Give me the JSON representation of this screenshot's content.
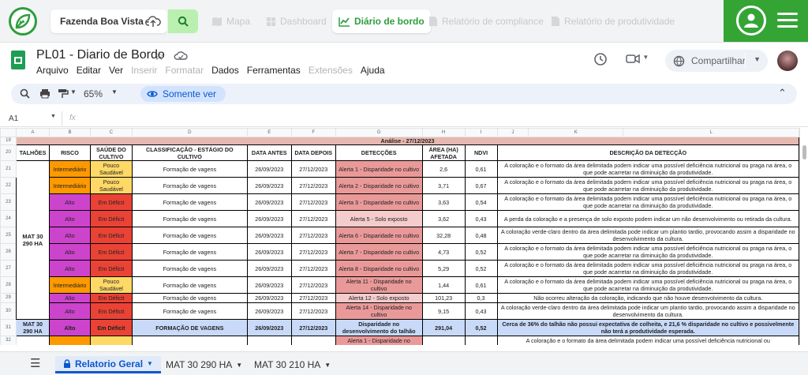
{
  "app": {
    "farm_name": "Fazenda Boa Vista -",
    "nav": [
      {
        "label": "Mapa",
        "icon": "map-icon"
      },
      {
        "label": "Dashboard",
        "icon": "dashboard-icon"
      },
      {
        "label": "Diário de bordo",
        "icon": "chart-line-icon",
        "active": true
      },
      {
        "label": "Relatório de compliance",
        "icon": "document-icon"
      },
      {
        "label": "Relatório de produtividade",
        "icon": "document-icon"
      }
    ],
    "accent_color": "#34a535"
  },
  "doc": {
    "title": "PL01 - Diario de Bordo",
    "menu": [
      {
        "label": "Arquivo",
        "disabled": false
      },
      {
        "label": "Editar",
        "disabled": false
      },
      {
        "label": "Ver",
        "disabled": false
      },
      {
        "label": "Inserir",
        "disabled": true
      },
      {
        "label": "Formatar",
        "disabled": true
      },
      {
        "label": "Dados",
        "disabled": false
      },
      {
        "label": "Ferramentas",
        "disabled": false
      },
      {
        "label": "Extensões",
        "disabled": true
      },
      {
        "label": "Ajuda",
        "disabled": false
      }
    ],
    "share_label": "Compartilhar"
  },
  "toolbar": {
    "zoom": "65%",
    "view_only_label": "Somente ver"
  },
  "formula_bar": {
    "cell_ref": "A1",
    "fx": "fx",
    "value": ""
  },
  "sheet": {
    "col_letters": [
      "A",
      "B",
      "C",
      "D",
      "E",
      "F",
      "G",
      "H",
      "I",
      "J",
      "K",
      "L"
    ],
    "section_title": "Análise - 27/12/2023",
    "headers": [
      "TALHÕES",
      "RISCO",
      "SAÚDE DO CULTIVO",
      "CLASSIFICAÇÃO - ESTÁGIO DO CULTIVO",
      "DATA ANTES",
      "DATA DEPOIS",
      "DETECÇÕES",
      "ÁREA (HA) AFETADA",
      "NDVI",
      "DESCRIÇÃO DA DETECÇÃO"
    ],
    "talhao_group": "MAT 30 290 HA",
    "rows": [
      {
        "rn": "21",
        "risco": "Intermediário",
        "saude": "Pouco Saudável",
        "classif": "Formação de vagens",
        "antes": "26/09/2023",
        "depois": "27/12/2023",
        "deteccao": "Alerta 1 - Disparidade no cultivo",
        "area": "2,6",
        "ndvi": "0,61",
        "desc": "A coloração e o formato da área delimitada podem indicar uma possível deficiência nutricional ou praga na área, o que pode acarretar na diminuição da produtividade."
      },
      {
        "rn": "22",
        "risco": "Intermediário",
        "saude": "Pouco Saudável",
        "classif": "Formação de vagens",
        "antes": "26/09/2023",
        "depois": "27/12/2023",
        "deteccao": "Alerta 2 - Disparidade no cultivo",
        "area": "3,71",
        "ndvi": "0,67",
        "desc": "A coloração e o formato da área delimitada podem indicar uma possível deficiência nutricional ou praga na área, o que pode acarretar na diminuição da produtividade."
      },
      {
        "rn": "23",
        "risco": "Alto",
        "saude": "Em Déficit",
        "classif": "Formação de vagens",
        "antes": "26/09/2023",
        "depois": "27/12/2023",
        "deteccao": "Alerta 3 - Disparidade no cultivo",
        "area": "3,63",
        "ndvi": "0,54",
        "desc": "A coloração e o formato da área delimitada podem indicar uma possível deficiência nutricional ou praga na área, o que pode acarretar na diminuição da produtividade."
      },
      {
        "rn": "24",
        "risco": "Alto",
        "saude": "Em Déficit",
        "classif": "Formação de vagens",
        "antes": "26/09/2023",
        "depois": "27/12/2023",
        "deteccao": "Alerta 5 - Solo exposto",
        "area": "3,62",
        "ndvi": "0,43",
        "desc": "A perda da coloração e a presença de solo exposto podem indicar um não desenvolvimento ou retirada da cultura.",
        "solo": true
      },
      {
        "rn": "25",
        "risco": "Alto",
        "saude": "Em Déficit",
        "classif": "Formação de vagens",
        "antes": "26/09/2023",
        "depois": "27/12/2023",
        "deteccao": "Alerta 6 - Disparidade no cultivo",
        "area": "32,28",
        "ndvi": "0,48",
        "desc": "A coloração verde-claro dentro da área delimitada pode indicar um plantio tardio, provocando assim a disparidade no desenvolvimento da cultura."
      },
      {
        "rn": "26",
        "risco": "Alto",
        "saude": "Em Déficit",
        "classif": "Formação de vagens",
        "antes": "26/09/2023",
        "depois": "27/12/2023",
        "deteccao": "Alerta 7 - Disparidade no cultivo",
        "area": "4,73",
        "ndvi": "0,52",
        "desc": "A coloração e o formato da área delimitada podem indicar uma possível deficiência nutricional ou praga na área, o que pode acarretar na diminuição da produtividade."
      },
      {
        "rn": "27",
        "risco": "Alto",
        "saude": "Em Déficit",
        "classif": "Formação de vagens",
        "antes": "26/09/2023",
        "depois": "27/12/2023",
        "deteccao": "Alerta 8 - Disparidade no cultivo",
        "area": "5,29",
        "ndvi": "0,52",
        "desc": "A coloração e o formato da área delimitada podem indicar uma possível deficiência nutricional ou praga na área, o que pode acarretar na diminuição da produtividade."
      },
      {
        "rn": "28",
        "risco": "Intermediário",
        "saude": "Pouco Saudável",
        "classif": "Formação de vagens",
        "antes": "26/09/2023",
        "depois": "27/12/2023",
        "deteccao": "Alerta 11 - Disparidade no cultivo",
        "area": "1,44",
        "ndvi": "0,61",
        "desc": "A coloração e o formato da área delimitada podem indicar uma possível deficiência nutricional ou praga na área, o que pode acarretar na diminuição da produtividade."
      },
      {
        "rn": "29",
        "risco": "Alto",
        "saude": "Em Déficit",
        "classif": "Formação de vagens",
        "antes": "26/09/2023",
        "depois": "27/12/2023",
        "deteccao": "Alerta 12 - Solo exposto",
        "area": "101,23",
        "ndvi": "0,3",
        "desc": "Não ocorreu alteração da coloração, indicando que não houve desenvolvimento da cultura.",
        "solo": true,
        "short": true
      },
      {
        "rn": "30",
        "risco": "Alto",
        "saude": "Em Déficit",
        "classif": "Formação de vagens",
        "antes": "26/09/2023",
        "depois": "27/12/2023",
        "deteccao": "Alerta 14 - Disparidade no cultivo",
        "area": "9,15",
        "ndvi": "0,43",
        "desc": "A coloração verde-claro dentro da área delimitada pode indicar um plantio tardio, provocando assim a disparidade no desenvolvimento da cultura."
      }
    ],
    "summary": {
      "rn": "31",
      "talhao": "MAT 30 290 HA",
      "risco": "Alto",
      "saude": "Em Déficit",
      "classif": "FORMAÇÃO DE VAGENS",
      "antes": "26/09/2023",
      "depois": "27/12/2023",
      "deteccao": "Disparidade no desenvolvimento do talhão",
      "area": "291,04",
      "ndvi": "0,52",
      "desc": "Cerca de 36% do talhão não possui expectativa de colheita, e 21,6 % disparidade no cultivo e possivelmente não terá a produtividade esperada."
    },
    "next_row": {
      "rn": "32",
      "deteccao": "Alerta 1 - Disparidade no",
      "desc": "A coloração e o formato da área delimitada podem indicar uma possível deficiência nutricional ou"
    }
  },
  "sheet_tabs": [
    {
      "label": "Relatorio Geral",
      "active": true
    },
    {
      "label": "MAT 30 290 HA",
      "active": false
    },
    {
      "label": "MAT 30 210 HA",
      "active": false
    }
  ],
  "colors": {
    "intermediario": "#ff9900",
    "alto": "#cc44cc",
    "pouco_saudavel": "#ffd966",
    "em_deficit": "#ea4335",
    "alert_red": "#ea9999",
    "alert_pink": "#f4cccc",
    "summary_blue": "#c9daf8",
    "section_header": "#e6b8af"
  }
}
